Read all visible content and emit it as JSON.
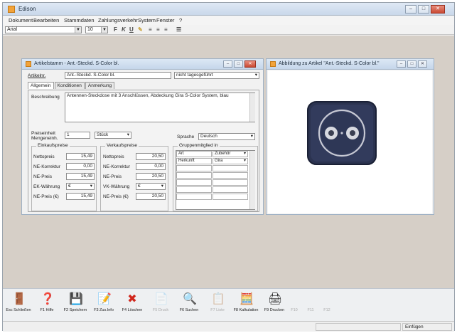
{
  "window": {
    "title": "Edison"
  },
  "menu": [
    "Dokument",
    "Bearbeiten",
    "Stammdaten",
    "Zahlungsverkehr",
    "System",
    "Fenster",
    "?"
  ],
  "toolbar": {
    "font": "Arial",
    "size": "10",
    "bold": "F",
    "italic": "K",
    "underline": "U"
  },
  "article_window": {
    "title": "Artikelstamm - Ant.-Steckd. S-Color bl.",
    "artikel_label": "Artikelnr.",
    "artikel_value": "Ant.-Steckd. S-Color bl.",
    "status_select": "nicht tagesgeführt",
    "tabs": [
      "Allgemein",
      "Konditionen",
      "Anmerkung"
    ],
    "beschreibung_label": "Beschreibung",
    "beschreibung_value": "Antennen-Steckdose mit 3 Anschlüssen, Abdeckung Gira S-Color System, blau",
    "mengeneinheit_label_1": "Preiseinheit",
    "mengeneinheit_label_2": "Mengeneinh.",
    "mengeneinheit_value": "1",
    "einheit_select": "Stück",
    "sprache_label": "Sprache",
    "sprache_select": "Deutsch",
    "einkauf": {
      "title": "Einkaufspreise",
      "rows": [
        {
          "label": "Nettopreis",
          "value": "15,49"
        },
        {
          "label": "NE-Korrektur",
          "value": "0,00"
        },
        {
          "label": "NE-Preis",
          "value": "15,49"
        },
        {
          "label": "EK-Währung",
          "value": "€"
        },
        {
          "label": "NE-Preis (€)",
          "value": "15,49"
        }
      ]
    },
    "verkauf": {
      "title": "Verkaufspreise",
      "rows": [
        {
          "label": "Nettopreis",
          "value": "20,50"
        },
        {
          "label": "NE-Korrektur",
          "value": "0,00"
        },
        {
          "label": "NE-Preis",
          "value": "20,50"
        },
        {
          "label": "VK-Währung",
          "value": "€"
        },
        {
          "label": "NE-Preis (€)",
          "value": "20,50"
        }
      ]
    },
    "gruppen": {
      "title": "Gruppenmitglied in",
      "rows": [
        {
          "key": "Art",
          "value": "Zubehör"
        },
        {
          "key": "Herkunft",
          "value": "Gira"
        }
      ]
    }
  },
  "image_window": {
    "title": "Abbildung zu Artikel \"Ant.-Steckd. S-Color bl.\""
  },
  "bottom_toolbar": [
    {
      "label": "Esc Schließen",
      "icon": "door-icon",
      "glyph": "🚪",
      "enabled": true
    },
    {
      "label": "F1 Hilfe",
      "icon": "help-icon",
      "glyph": "❓",
      "enabled": true
    },
    {
      "label": "F2 Speichern",
      "icon": "save-icon",
      "glyph": "💾",
      "enabled": true
    },
    {
      "label": "F3 Zus.Info",
      "icon": "info-doc-icon",
      "glyph": "📝",
      "enabled": true
    },
    {
      "label": "F4 Löschen",
      "icon": "delete-icon",
      "glyph": "✖",
      "enabled": true
    },
    {
      "label": "F5 Druck",
      "icon": "print-preview-icon",
      "glyph": "📄",
      "enabled": false
    },
    {
      "label": "F6 Suchen",
      "icon": "search-icon",
      "glyph": "🔍",
      "enabled": true
    },
    {
      "label": "F7 Liste",
      "icon": "list-icon",
      "glyph": "📋",
      "enabled": false
    },
    {
      "label": "F8 Kalkulation",
      "icon": "calculator-icon",
      "glyph": "🧮",
      "enabled": true
    },
    {
      "label": "F9 Drucken",
      "icon": "printer-icon",
      "glyph": "🖨",
      "enabled": true
    },
    {
      "label": "F10",
      "icon": "blank-icon",
      "glyph": "",
      "enabled": false
    },
    {
      "label": "F11",
      "icon": "blank-icon",
      "glyph": "",
      "enabled": false
    },
    {
      "label": "F12",
      "icon": "blank-icon",
      "glyph": "",
      "enabled": false
    }
  ],
  "status": {
    "mode": "Einfügen"
  }
}
